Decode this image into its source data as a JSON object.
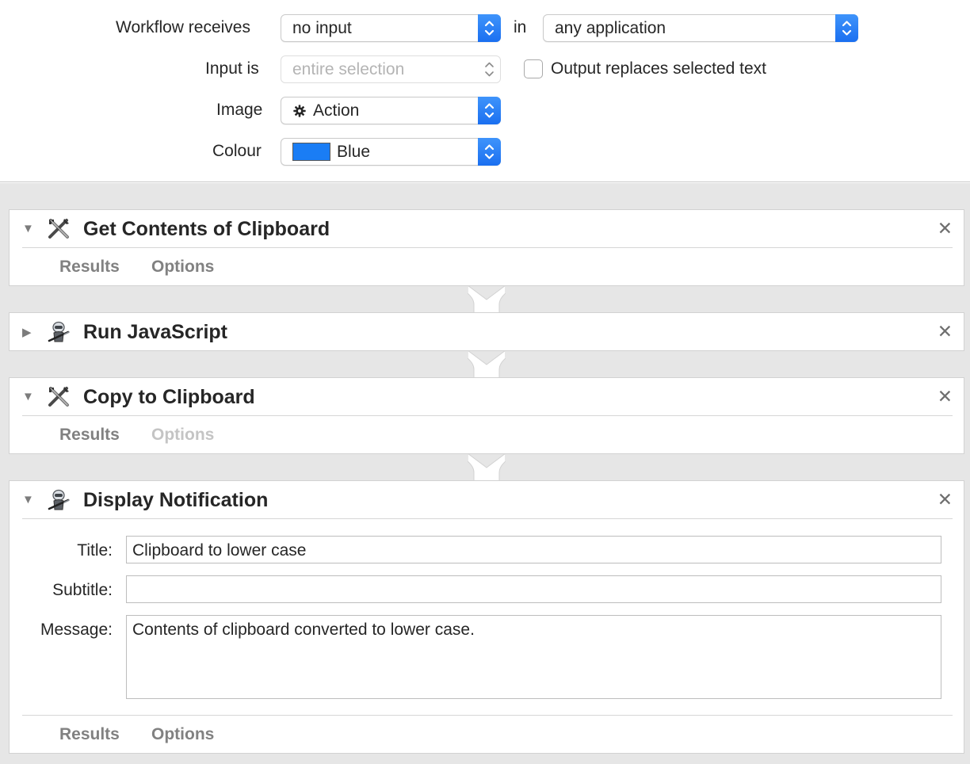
{
  "settings": {
    "receives_label": "Workflow receives",
    "receives_value": "no input",
    "in_label": "in",
    "application_value": "any application",
    "input_is_label": "Input is",
    "input_is_value": "entire selection",
    "output_replaces_label": "Output replaces selected text",
    "output_replaces_checked": false,
    "image_label": "Image",
    "image_value": "Action",
    "image_icon": "gear-icon",
    "colour_label": "Colour",
    "colour_value": "Blue",
    "colour_swatch": "#1a7df5"
  },
  "actions": [
    {
      "title": "Get Contents of Clipboard",
      "icon": "tools-icon",
      "expanded": true,
      "results_label": "Results",
      "options_label": "Options",
      "options_enabled": true
    },
    {
      "title": "Run JavaScript",
      "icon": "automator-robot-icon",
      "expanded": false
    },
    {
      "title": "Copy to Clipboard",
      "icon": "tools-icon",
      "expanded": true,
      "results_label": "Results",
      "options_label": "Options",
      "options_enabled": false
    },
    {
      "title": "Display Notification",
      "icon": "automator-robot-icon",
      "expanded": true,
      "fields": {
        "title_label": "Title:",
        "title_value": "Clipboard to lower case",
        "subtitle_label": "Subtitle:",
        "subtitle_value": "",
        "message_label": "Message:",
        "message_value": "Contents of clipboard converted to lower case."
      },
      "results_label": "Results",
      "options_label": "Options",
      "options_enabled": true
    }
  ],
  "colors": {
    "accent": "#1a6ff0",
    "workflow_background": "#e6e6e6"
  }
}
